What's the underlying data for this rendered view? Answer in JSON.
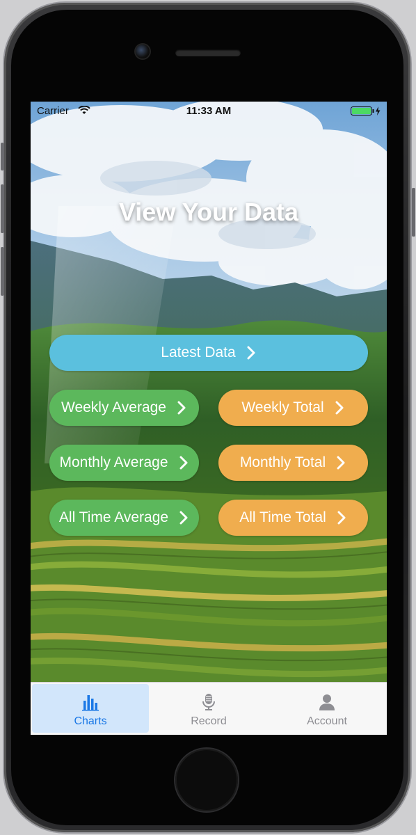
{
  "status_bar": {
    "carrier": "Carrier",
    "time": "11:33 AM"
  },
  "title": "View Your Data",
  "buttons": {
    "latest": "Latest Data",
    "weekly_average": "Weekly Average",
    "weekly_total": "Weekly Total",
    "monthly_average": "Monthly Average",
    "monthly_total": "Monthly Total",
    "all_time_average": "All Time Average",
    "all_time_total": "All Time Total"
  },
  "tabs": [
    {
      "label": "Charts",
      "icon": "bar-chart-icon",
      "active": true
    },
    {
      "label": "Record",
      "icon": "microphone-icon",
      "active": false
    },
    {
      "label": "Account",
      "icon": "user-icon",
      "active": false
    }
  ],
  "colors": {
    "latest": "#5bc0de",
    "average": "#5cb85c",
    "total": "#f0ad4e",
    "tab_active": "#1a78e6"
  }
}
